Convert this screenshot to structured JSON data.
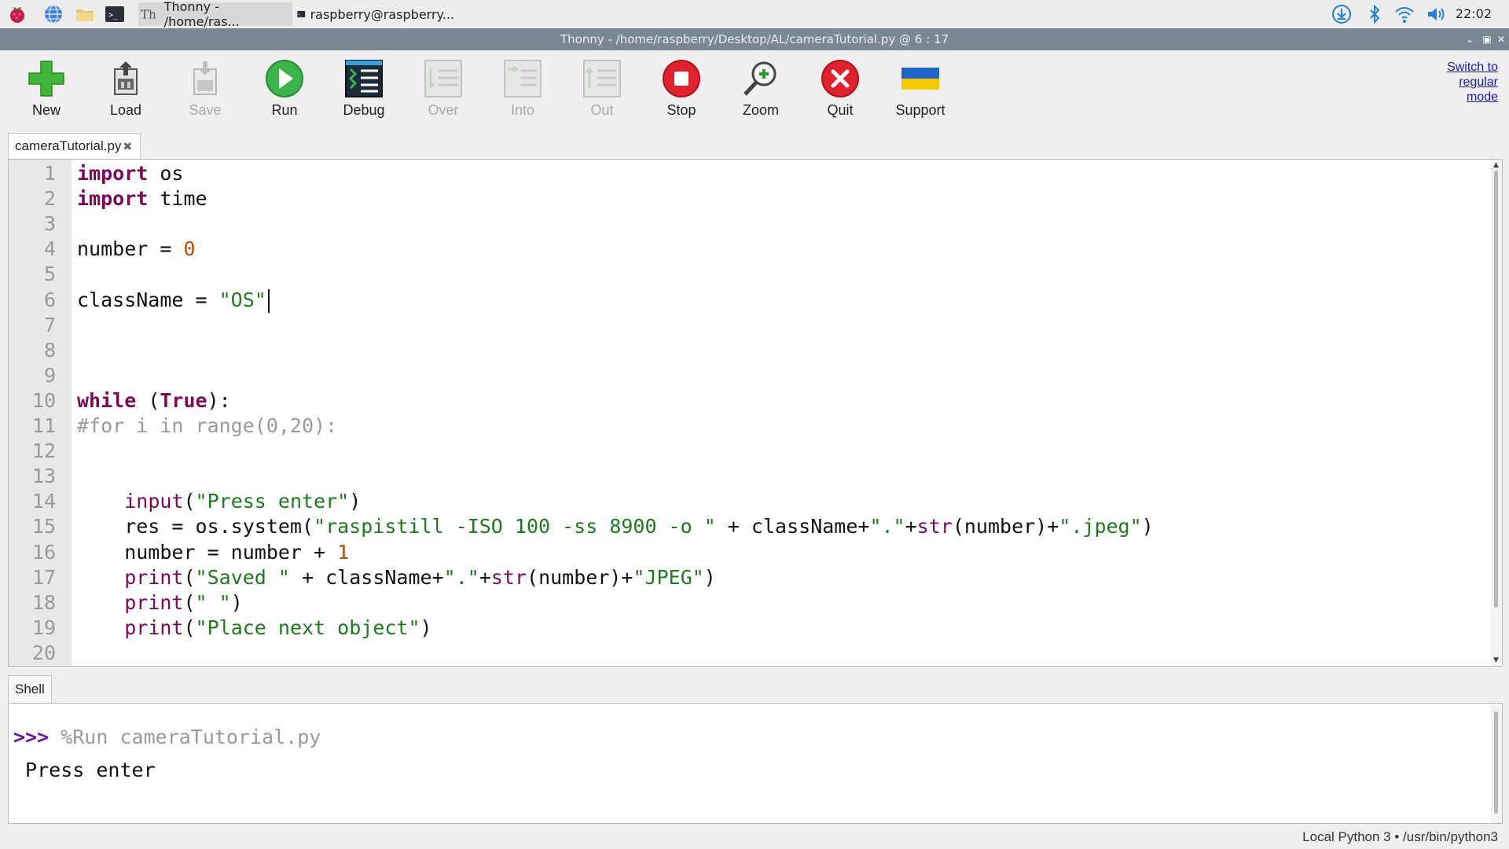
{
  "taskbar": {
    "tasks": [
      {
        "label": "Thonny  -  /home/ras..."
      },
      {
        "label": "raspberry@raspberry..."
      }
    ],
    "clock": "22:02"
  },
  "window": {
    "title": "Thonny  -  /home/raspberry/Desktop/AL/cameraTutorial.py  @  6 : 17"
  },
  "toolbar": {
    "buttons": [
      {
        "label": "New",
        "icon": "new-file-icon",
        "enabled": true
      },
      {
        "label": "Load",
        "icon": "load-icon",
        "enabled": true
      },
      {
        "label": "Save",
        "icon": "save-icon",
        "enabled": false
      },
      {
        "label": "Run",
        "icon": "run-icon",
        "enabled": true
      },
      {
        "label": "Debug",
        "icon": "debug-icon",
        "enabled": true
      },
      {
        "label": "Over",
        "icon": "step-over-icon",
        "enabled": false
      },
      {
        "label": "Into",
        "icon": "step-into-icon",
        "enabled": false
      },
      {
        "label": "Out",
        "icon": "step-out-icon",
        "enabled": false
      },
      {
        "label": "Stop",
        "icon": "stop-icon",
        "enabled": true
      },
      {
        "label": "Zoom",
        "icon": "zoom-icon",
        "enabled": true
      },
      {
        "label": "Quit",
        "icon": "quit-icon",
        "enabled": true
      },
      {
        "label": "Support",
        "icon": "ukraine-flag-icon",
        "enabled": true
      }
    ],
    "switch_mode": [
      "Switch to",
      "regular",
      "mode"
    ]
  },
  "editor": {
    "tab_label": "cameraTutorial.py",
    "line_numbers": [
      "1",
      "2",
      "3",
      "4",
      "5",
      "6",
      "7",
      "8",
      "9",
      "10",
      "11",
      "12",
      "13",
      "14",
      "15",
      "16",
      "17",
      "18",
      "19",
      "20"
    ],
    "lines": [
      [
        {
          "t": "import",
          "c": "kw"
        },
        {
          "t": " os",
          "c": ""
        }
      ],
      [
        {
          "t": "import",
          "c": "kw"
        },
        {
          "t": " time",
          "c": ""
        }
      ],
      [],
      [
        {
          "t": "number = ",
          "c": ""
        },
        {
          "t": "0",
          "c": "nm"
        }
      ],
      [],
      [
        {
          "t": "className = ",
          "c": ""
        },
        {
          "t": "\"OS\"",
          "c": "st"
        }
      ],
      [],
      [],
      [],
      [
        {
          "t": "while",
          "c": "kw"
        },
        {
          "t": " (",
          "c": ""
        },
        {
          "t": "True",
          "c": "kw"
        },
        {
          "t": "):",
          "c": ""
        }
      ],
      [
        {
          "t": "#for i in range(0,20):",
          "c": "cm"
        }
      ],
      [],
      [],
      [
        {
          "t": "    ",
          "c": ""
        },
        {
          "t": "input",
          "c": "bi"
        },
        {
          "t": "(",
          "c": ""
        },
        {
          "t": "\"Press enter\"",
          "c": "st"
        },
        {
          "t": ")",
          "c": ""
        }
      ],
      [
        {
          "t": "    res = os.system(",
          "c": ""
        },
        {
          "t": "\"raspistill -ISO 100 -ss 8900 -o \"",
          "c": "st"
        },
        {
          "t": " + className+",
          "c": ""
        },
        {
          "t": "\".\"",
          "c": "st"
        },
        {
          "t": "+",
          "c": ""
        },
        {
          "t": "str",
          "c": "bi"
        },
        {
          "t": "(number)+",
          "c": ""
        },
        {
          "t": "\".jpeg\"",
          "c": "st"
        },
        {
          "t": ")",
          "c": ""
        }
      ],
      [
        {
          "t": "    number = number + ",
          "c": ""
        },
        {
          "t": "1",
          "c": "nm"
        }
      ],
      [
        {
          "t": "    ",
          "c": ""
        },
        {
          "t": "print",
          "c": "bi"
        },
        {
          "t": "(",
          "c": ""
        },
        {
          "t": "\"Saved \"",
          "c": "st"
        },
        {
          "t": " + className+",
          "c": ""
        },
        {
          "t": "\".\"",
          "c": "st"
        },
        {
          "t": "+",
          "c": ""
        },
        {
          "t": "str",
          "c": "bi"
        },
        {
          "t": "(number)+",
          "c": ""
        },
        {
          "t": "\"JPEG\"",
          "c": "st"
        },
        {
          "t": ")",
          "c": ""
        }
      ],
      [
        {
          "t": "    ",
          "c": ""
        },
        {
          "t": "print",
          "c": "bi"
        },
        {
          "t": "(",
          "c": ""
        },
        {
          "t": "\" \"",
          "c": "st"
        },
        {
          "t": ")",
          "c": ""
        }
      ],
      [
        {
          "t": "    ",
          "c": ""
        },
        {
          "t": "print",
          "c": "bi"
        },
        {
          "t": "(",
          "c": ""
        },
        {
          "t": "\"Place next object\"",
          "c": "st"
        },
        {
          "t": ")",
          "c": ""
        }
      ],
      []
    ],
    "cursor": {
      "line": 6,
      "column": 17
    }
  },
  "shell": {
    "tab_label": "Shell",
    "prompt": ">>>",
    "command": " %Run cameraTutorial.py",
    "output": " Press enter"
  },
  "status": {
    "text": "Local Python 3  •  /usr/bin/python3"
  }
}
